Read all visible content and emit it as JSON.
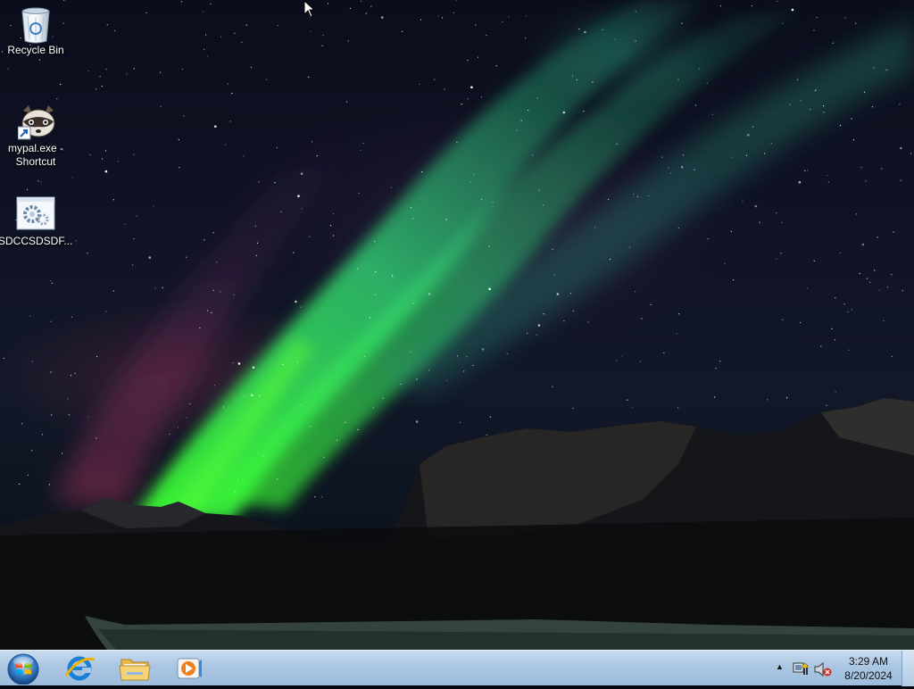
{
  "desktop": {
    "icons": [
      {
        "label": "Recycle Bin",
        "icon": "recycle-bin-icon"
      },
      {
        "label": "mypal.exe - Shortcut",
        "icon": "raccoon-app-icon"
      },
      {
        "label": "SDCCSDSDF...",
        "icon": "settings-gear-file-icon"
      }
    ]
  },
  "taskbar": {
    "start": {
      "icon": "windows-logo-icon"
    },
    "pinned": [
      {
        "icon": "internet-explorer-icon"
      },
      {
        "icon": "file-explorer-folder-icon"
      },
      {
        "icon": "media-player-icon"
      }
    ],
    "tray": {
      "show_hidden": "▲",
      "icons": [
        "network-icon",
        "volume-muted-icon"
      ],
      "time": "3:29 AM",
      "date": "8/20/2024"
    }
  },
  "colors": {
    "taskbar_top": "#c9dcef",
    "taskbar_bottom": "#9dbcdc",
    "aurora_green": "#3cff6a",
    "sky": "#0b0d1c"
  }
}
